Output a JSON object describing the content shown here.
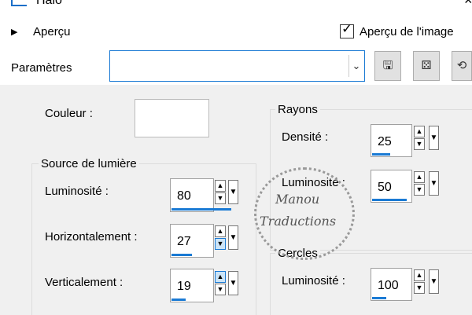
{
  "window": {
    "title": "Halo",
    "close_glyph": "×"
  },
  "toolbar": {
    "preview_section_label": "Aperçu",
    "preview_checkbox_label": "Aperçu de l'image",
    "preview_checked": true,
    "params_label": "Paramètres",
    "preset_value": "",
    "icons": [
      "save-icon",
      "random-dice-icon",
      "reset-icon"
    ]
  },
  "left_panel": {
    "color_label": "Couleur :",
    "color_value": "#ffffff",
    "light_source_title": "Source de lumière",
    "fields": [
      {
        "label": "Luminosité :",
        "value": "80"
      },
      {
        "label": "Horizontalement :",
        "value": "27"
      },
      {
        "label": "Verticalement :",
        "value": "19"
      }
    ]
  },
  "right_panel": {
    "rays_title": "Rayons",
    "rays_fields": [
      {
        "label": "Densité :",
        "value": "25"
      },
      {
        "label": "Luminosité :",
        "value": "50"
      }
    ],
    "circles_title": "Cercles",
    "circles_fields": [
      {
        "label": "Luminosité :",
        "value": "100"
      }
    ]
  },
  "watermark": {
    "line1": "Manou",
    "line2": "Traductions"
  },
  "colors": {
    "accent": "#1a7ad4",
    "panel_bg": "#f0f0f0"
  }
}
